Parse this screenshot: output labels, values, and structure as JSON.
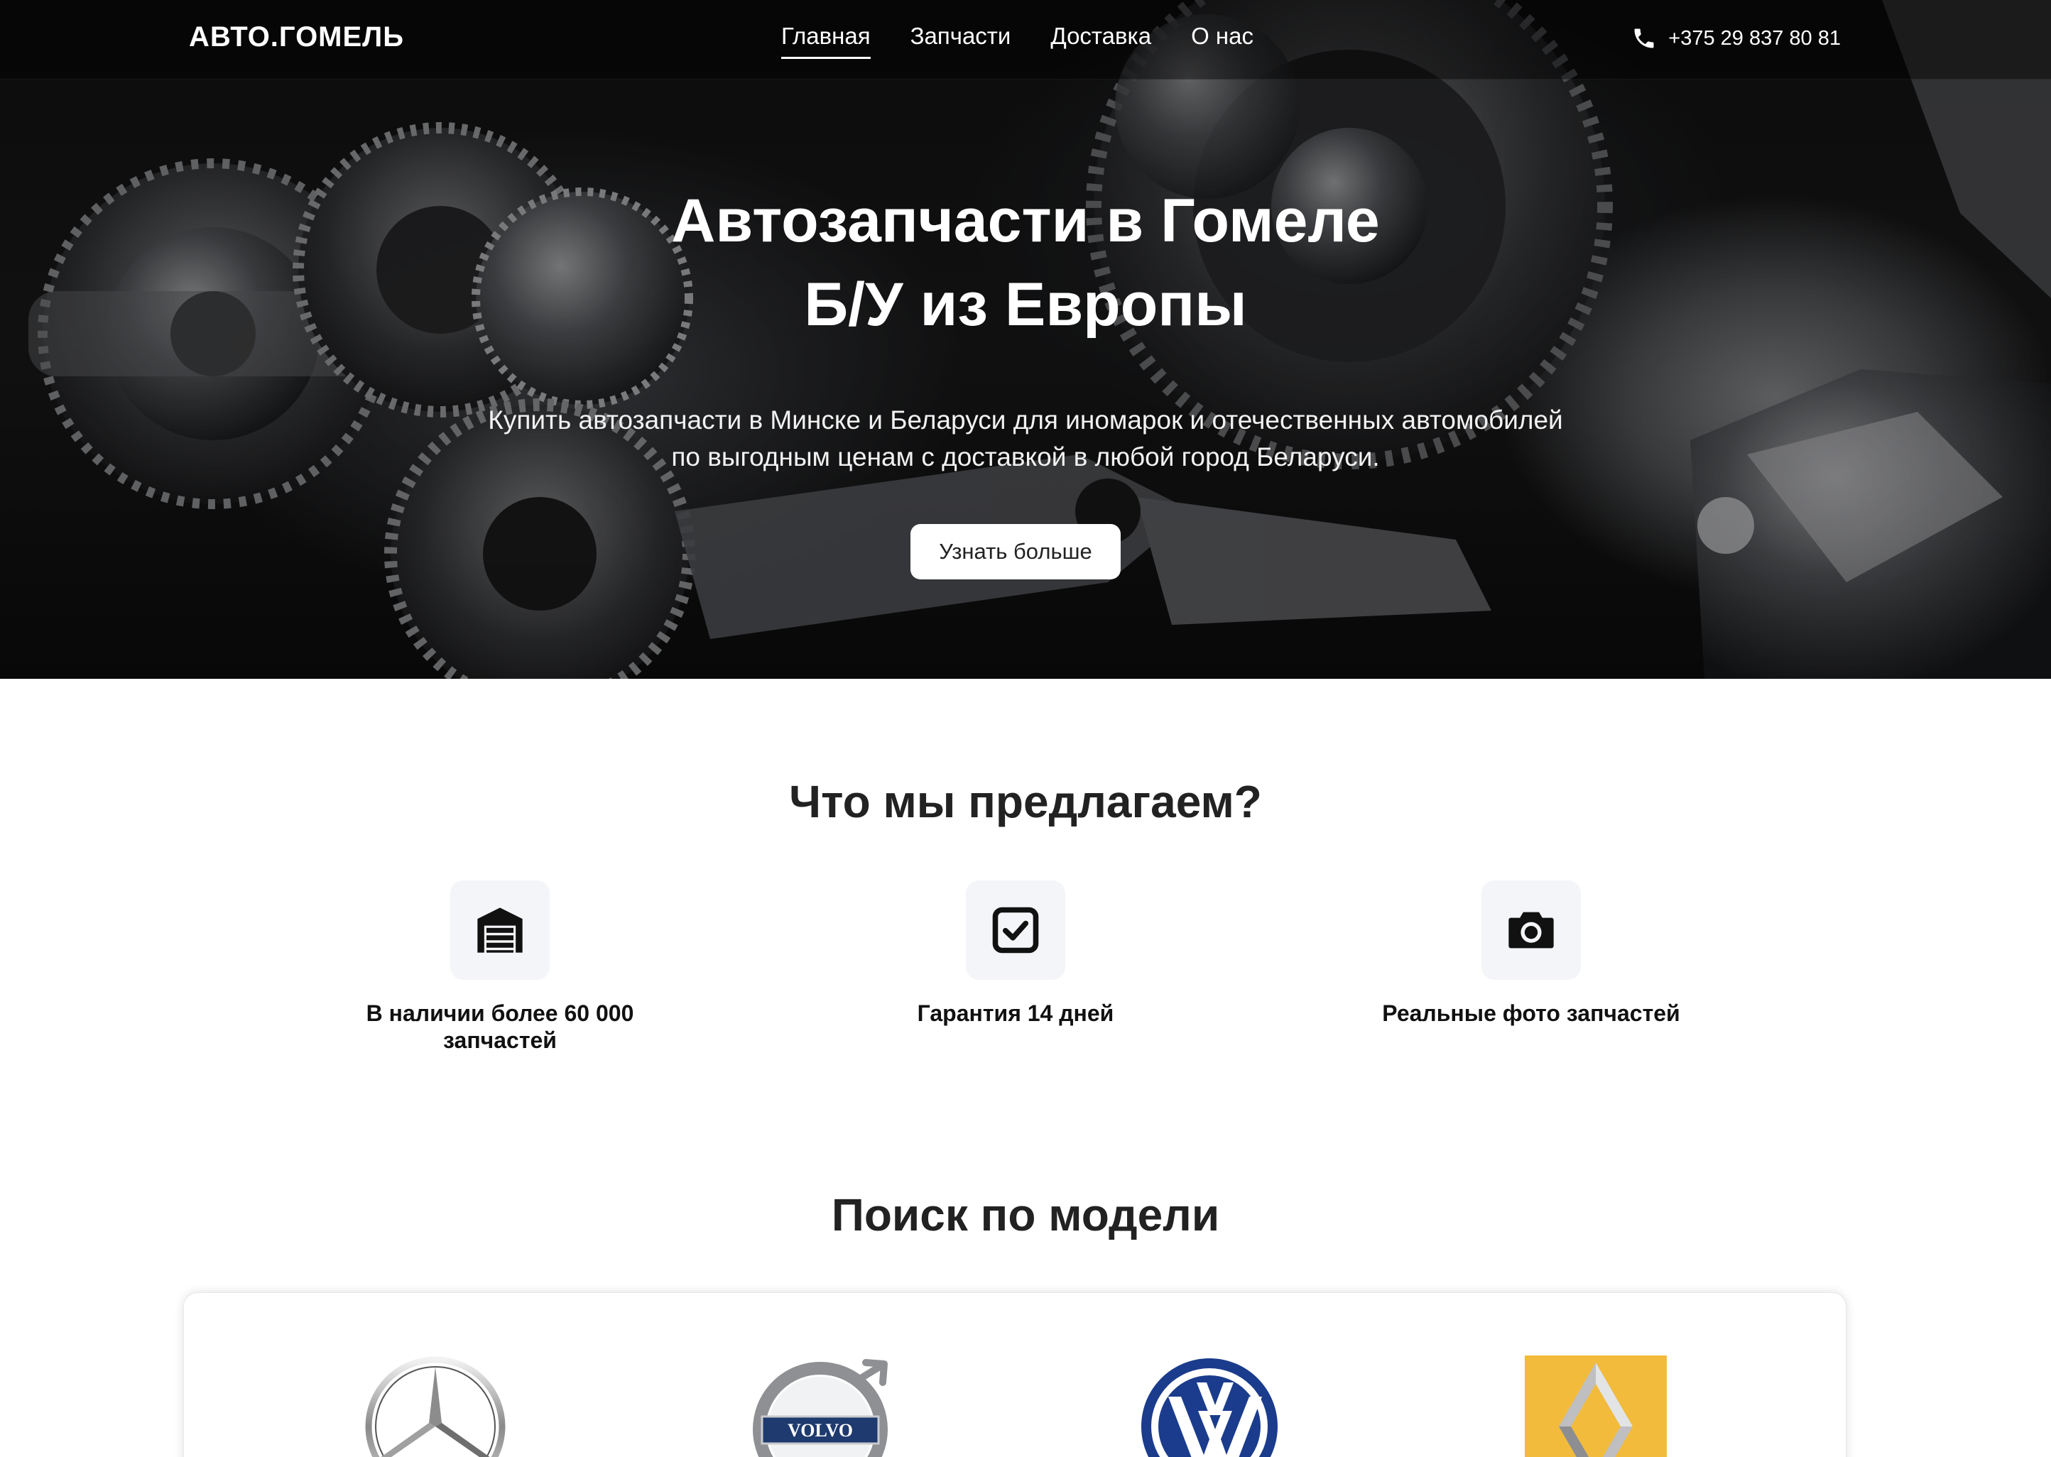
{
  "nav": {
    "logo": "АВТО.ГОМЕЛЬ",
    "items": [
      {
        "label": "Главная",
        "active": true
      },
      {
        "label": "Запчасти",
        "active": false
      },
      {
        "label": "Доставка",
        "active": false
      },
      {
        "label": "О нас",
        "active": false
      }
    ],
    "phone": "+375 29 837 80 81",
    "phone_icon": "phone-icon"
  },
  "hero": {
    "title_line1": "Автозапчасти в Гомеле",
    "title_line2": "Б/У из Европы",
    "subtitle_line1": "Купить автозапчасти в Минске и Беларуси для иномарок и отечественных автомобилей",
    "subtitle_line2": "по выгодным ценам с доставкой в любой город Беларуси.",
    "button": "Узнать больше"
  },
  "offer": {
    "title": "Что мы предлагаем?",
    "features": [
      {
        "icon": "warehouse-icon",
        "label_line1": "В наличии более 60 000",
        "label_line2": "запчастей"
      },
      {
        "icon": "checkbox-icon",
        "label_line1": "Гарантия 14 дней",
        "label_line2": ""
      },
      {
        "icon": "camera-icon",
        "label_line1": "Реальные фото запчастей",
        "label_line2": ""
      }
    ]
  },
  "models": {
    "title": "Поиск по модели",
    "brands": [
      {
        "icon": "mercedes-logo",
        "logo_text": ""
      },
      {
        "icon": "volvo-logo",
        "logo_text": "VOLVO"
      },
      {
        "icon": "volkswagen-logo",
        "logo_text": ""
      },
      {
        "icon": "renault-logo",
        "logo_text": ""
      }
    ]
  },
  "colors": {
    "accent_text": "#222222",
    "icon_bg": "#f4f5f8",
    "vw_blue": "#1b3c8c",
    "renault_yellow": "#f2bb3b",
    "volvo_blue": "#1e3a6e"
  }
}
